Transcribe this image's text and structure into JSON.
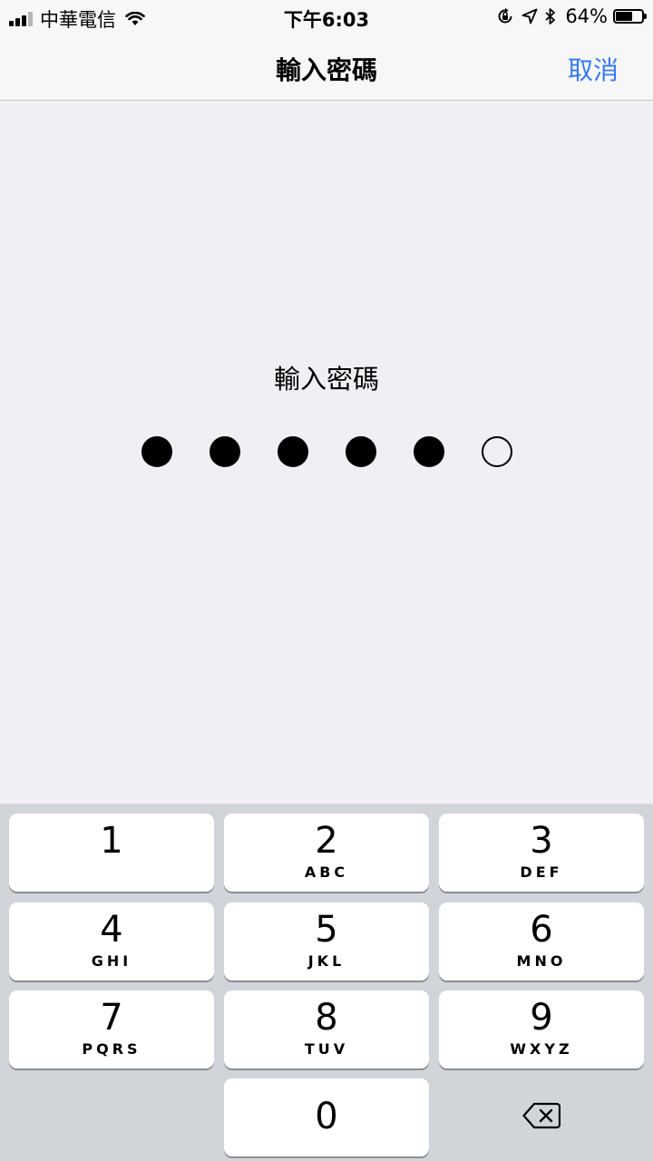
{
  "status_bar": {
    "carrier": "中華電信",
    "time": "下午6:03",
    "battery_percent": "64%",
    "battery_level": 0.64
  },
  "nav": {
    "title": "輸入密碼",
    "cancel_label": "取消",
    "accent_color": "#3478f6"
  },
  "passcode": {
    "prompt": "輸入密碼",
    "length": 6,
    "entered": 5
  },
  "keypad": {
    "keys": [
      {
        "digit": "1",
        "letters": ""
      },
      {
        "digit": "2",
        "letters": "ABC"
      },
      {
        "digit": "3",
        "letters": "DEF"
      },
      {
        "digit": "4",
        "letters": "GHI"
      },
      {
        "digit": "5",
        "letters": "JKL"
      },
      {
        "digit": "6",
        "letters": "MNO"
      },
      {
        "digit": "7",
        "letters": "PQRS"
      },
      {
        "digit": "8",
        "letters": "TUV"
      },
      {
        "digit": "9",
        "letters": "WXYZ"
      },
      {
        "digit": "0",
        "letters": ""
      }
    ],
    "delete_icon": "backspace-icon"
  }
}
